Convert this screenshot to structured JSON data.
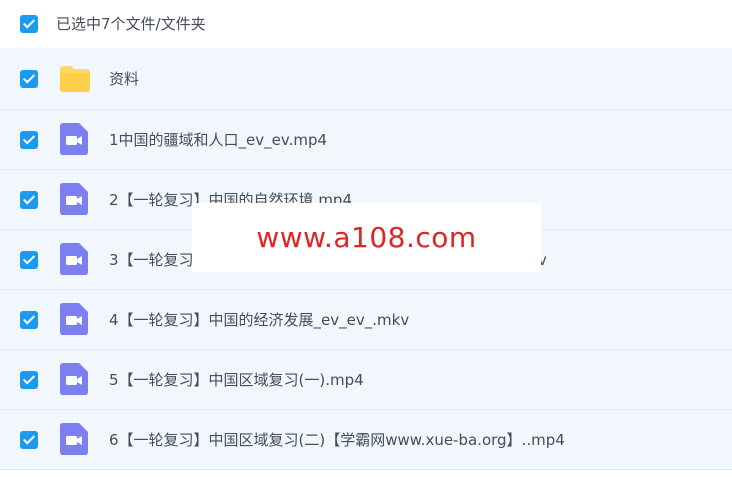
{
  "header": {
    "selected_text": "已选中7个文件/文件夹"
  },
  "files": [
    {
      "name": "资料",
      "type": "folder"
    },
    {
      "name": "1中国的疆域和人口_ev_ev.mp4",
      "type": "video"
    },
    {
      "name": "2【一轮复习】中国的自然环境.mp4",
      "type": "video"
    },
    {
      "name": "3【一轮复习】中国的自然资源【学霸网www.xue-ba.org】.mkv",
      "type": "video"
    },
    {
      "name": "4【一轮复习】中国的经济发展_ev_ev_.mkv",
      "type": "video"
    },
    {
      "name": "5【一轮复习】中国区域复习(一).mp4",
      "type": "video"
    },
    {
      "name": "6【一轮复习】中国区域复习(二)【学霸网www.xue-ba.org】..mp4",
      "type": "video"
    }
  ],
  "watermark": "www.a108.com",
  "colors": {
    "accent": "#1b9aee",
    "row_bg": "#f1f7fd",
    "folder": "#ffd766",
    "video": "#7b7ff0",
    "watermark": "#e02424"
  }
}
